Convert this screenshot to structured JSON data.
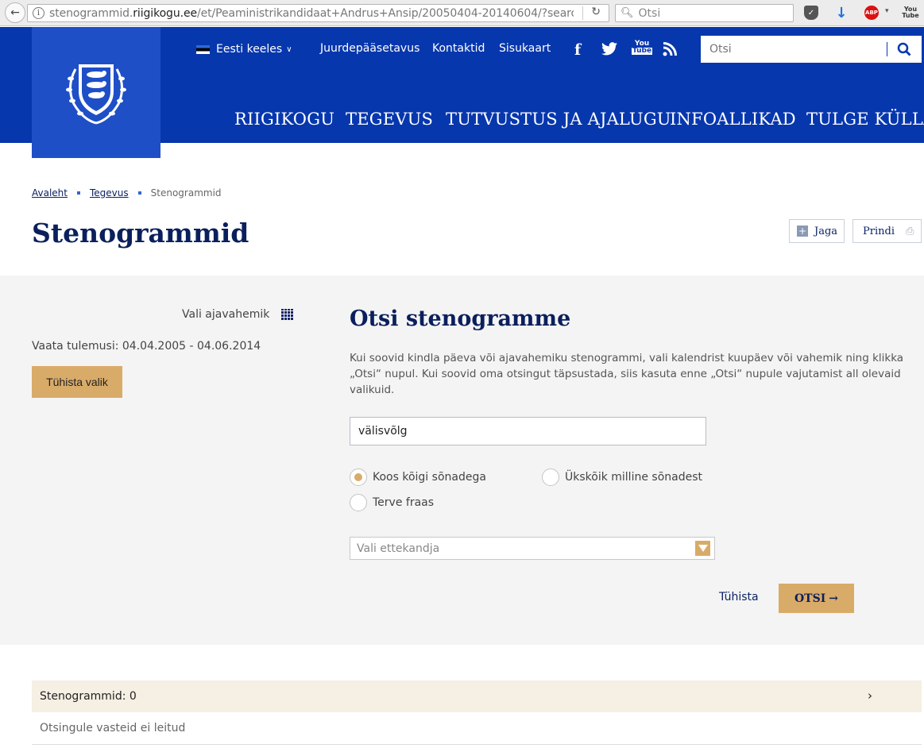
{
  "browser": {
    "url_prefix": "stenogrammid.",
    "url_domain": "riigikogu.ee",
    "url_path": "/et/Peaministrikandidaat+Andrus+Ansip/20050404-20140604/?searc",
    "search_placeholder": "Otsi"
  },
  "header": {
    "language": "Eesti keeles",
    "util_links": [
      "Juurdepääsetavus",
      "Kontaktid",
      "Sisukaart"
    ],
    "search_placeholder": "Otsi",
    "nav": [
      "RIIGIKOGU",
      "TEGEVUS",
      "TUTVUSTUS JA AJALUGU",
      "INFOALLIKAD",
      "TULGE KÜLLA"
    ]
  },
  "breadcrumb": {
    "home": "Avaleht",
    "parent": "Tegevus",
    "current": "Stenogrammid"
  },
  "page": {
    "title": "Stenogrammid",
    "share_label": "Jaga",
    "print_label": "Prindi"
  },
  "filter": {
    "date_picker_label": "Vali ajavahemik",
    "results_range": "Vaata tulemusi: 04.04.2005 - 04.06.2014",
    "clear_selection": "Tühista valik"
  },
  "search": {
    "title": "Otsi stenogramme",
    "help_text": "Kui soovid kindla päeva või ajavahemiku stenogrammi, vali kalendrist kuupäev või vahemik ning klikka „Otsi“ nupul. Kui soovid oma otsingut täpsustada, siis kasuta enne „Otsi“ nupule vajutamist all olevaid valikuid.",
    "keyword": "välisvõlg",
    "options": [
      "Koos kõigi sõnadega",
      "Ükskõik milline sõnadest",
      "Terve fraas"
    ],
    "selected_option": "Koos kõigi sõnadega",
    "speaker_placeholder": "Vali ettekandja",
    "cancel_label": "Tühista",
    "submit_label": "OTSI"
  },
  "results": {
    "header": "Stenogrammid: 0",
    "empty_message": "Otsingule vasteid ei leitud"
  },
  "colors": {
    "header_blue": "#0737ad",
    "logo_blue": "#1e4fc6",
    "accent_gold": "#d9ab69",
    "title_navy": "#0a1f5c"
  }
}
